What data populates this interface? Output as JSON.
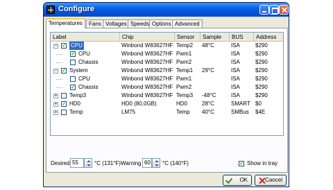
{
  "window": {
    "title": "Configure"
  },
  "tabs": [
    {
      "label": "Temperatures",
      "active": true
    },
    {
      "label": "Fans",
      "active": false
    },
    {
      "label": "Voltages",
      "active": false
    },
    {
      "label": "Speeds",
      "active": false
    },
    {
      "label": "Options",
      "active": false
    },
    {
      "label": "Advanced",
      "active": false
    }
  ],
  "table": {
    "columns": [
      "Label",
      "Chip",
      "Sensor",
      "Sample",
      "BUS",
      "Address"
    ],
    "rows": [
      {
        "label": "CPU",
        "expander": "−",
        "checked": true,
        "selected": true,
        "chip": "Winbond W83627HF",
        "sensor": "Temp2",
        "sample": "48°C",
        "bus": "ISA",
        "address": "$290"
      },
      {
        "label": "CPU",
        "expander": "",
        "checked": true,
        "selected": false,
        "chip": "Winbond W83627HF",
        "sensor": "Pwm1",
        "sample": "",
        "bus": "ISA",
        "address": "$290"
      },
      {
        "label": "Chassis",
        "expander": "",
        "checked": false,
        "selected": false,
        "chip": "Winbond W83627HF",
        "sensor": "Pwm2",
        "sample": "",
        "bus": "ISA",
        "address": "$290"
      },
      {
        "label": "System",
        "expander": "−",
        "checked": true,
        "selected": false,
        "chip": "Winbond W83627HF",
        "sensor": "Temp1",
        "sample": "29°C",
        "bus": "ISA",
        "address": "$290"
      },
      {
        "label": "CPU",
        "expander": "",
        "checked": false,
        "selected": false,
        "chip": "Winbond W83627HF",
        "sensor": "Pwm1",
        "sample": "",
        "bus": "ISA",
        "address": "$290"
      },
      {
        "label": "Chassis",
        "expander": "",
        "checked": true,
        "selected": false,
        "chip": "Winbond W83627HF",
        "sensor": "Pwm2",
        "sample": "",
        "bus": "ISA",
        "address": "$290"
      },
      {
        "label": "Temp3",
        "expander": "+",
        "checked": false,
        "selected": false,
        "chip": "Winbond W83627HF",
        "sensor": "Temp3",
        "sample": "-48°C",
        "bus": "ISA",
        "address": "$290"
      },
      {
        "label": "HD0",
        "expander": "+",
        "checked": true,
        "selected": false,
        "chip": "HD0 (80,0GB)",
        "sensor": "HD0",
        "sample": "28°C",
        "bus": "SMART",
        "address": "$0"
      },
      {
        "label": "Temp",
        "expander": "+",
        "checked": false,
        "selected": false,
        "chip": "LM75",
        "sensor": "Temp",
        "sample": "40°C",
        "bus": "SMBus",
        "address": "$4E"
      }
    ]
  },
  "bottom": {
    "desired_label": "Desired",
    "desired_value": "55",
    "desired_unit": "°C (131°F)",
    "warning_label": "Warning",
    "warning_value": "60",
    "warning_unit": "°C (140°F)",
    "show_in_tray_label": "Show in tray",
    "show_in_tray_checked": true
  },
  "buttons": {
    "ok_label": "OK",
    "cancel_label": "Cancel"
  },
  "icons": {
    "app": "cross-app-icon",
    "minimize": "minimize-icon",
    "maximize": "maximize-icon",
    "close": "close-icon",
    "expand": "expand-icon",
    "collapse": "collapse-icon",
    "checkbox": "checkbox-icon",
    "spin": "spin-icon",
    "ok": "checkmark-icon",
    "cancel": "cancel-x-icon"
  }
}
